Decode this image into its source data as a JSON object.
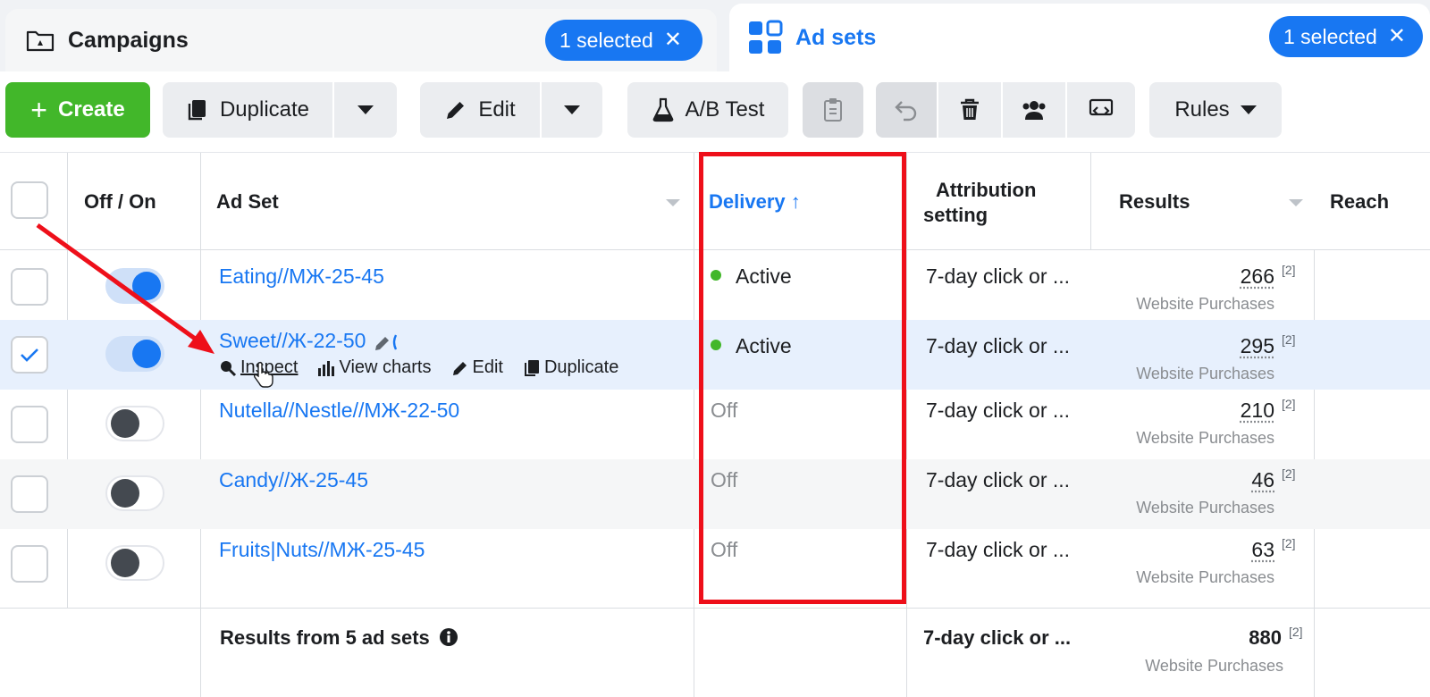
{
  "tabs": {
    "campaigns": {
      "label": "Campaigns",
      "selected": "1 selected"
    },
    "adsets": {
      "label": "Ad sets",
      "selected": "1 selected"
    }
  },
  "toolbar": {
    "create": "Create",
    "duplicate": "Duplicate",
    "edit": "Edit",
    "ab_test": "A/B Test",
    "rules": "Rules"
  },
  "table": {
    "headers": {
      "toggle": "Off / On",
      "adset": "Ad Set",
      "delivery": "Delivery",
      "attribution_line1": "Attribution",
      "attribution_line2": "setting",
      "results": "Results",
      "reach": "Reach"
    },
    "rows": [
      {
        "name": "Eating//МЖ-25-45",
        "on": true,
        "selected": false,
        "delivery": "Active",
        "attribution": "7-day click or ...",
        "results": "266",
        "results_label": "Website Purchases"
      },
      {
        "name": "Sweet//Ж-22-50",
        "on": true,
        "selected": true,
        "delivery": "Active",
        "attribution": "7-day click or ...",
        "results": "295",
        "results_label": "Website Purchases"
      },
      {
        "name": "Nutella//Nestle//МЖ-22-50",
        "on": false,
        "selected": false,
        "delivery": "Off",
        "attribution": "7-day click or ...",
        "results": "210",
        "results_label": "Website Purchases"
      },
      {
        "name": "Candy//Ж-25-45",
        "on": false,
        "selected": false,
        "delivery": "Off",
        "attribution": "7-day click or ...",
        "results": "46",
        "results_label": "Website Purchases"
      },
      {
        "name": "Fruits|Nuts//МЖ-25-45",
        "on": false,
        "selected": false,
        "delivery": "Off",
        "attribution": "7-day click or ...",
        "results": "63",
        "results_label": "Website Purchases"
      }
    ],
    "footnote": "[2]",
    "hover_actions": {
      "inspect": "Inspect",
      "view_charts": "View charts",
      "edit": "Edit",
      "duplicate": "Duplicate"
    },
    "totals": {
      "label": "Results from 5 ad sets",
      "attribution": "7-day click or ...",
      "results": "880",
      "results_label": "Website Purchases"
    }
  },
  "colors": {
    "accent": "#1877f2",
    "create": "#42b72a",
    "annotation": "#ee0f1a"
  }
}
